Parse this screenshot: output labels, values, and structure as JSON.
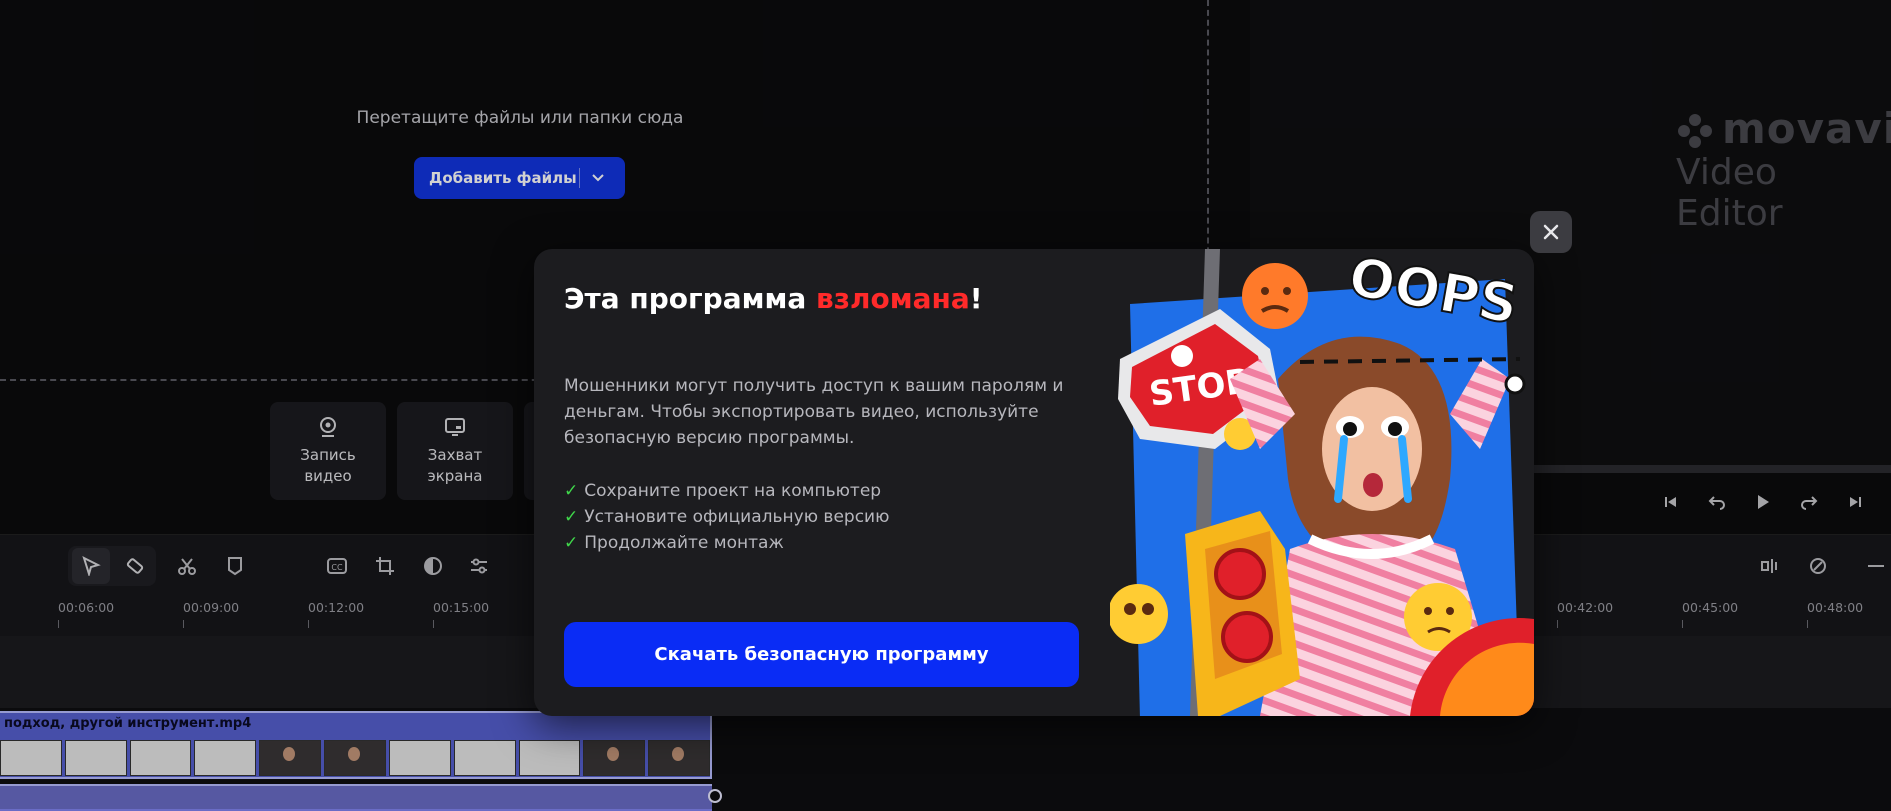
{
  "import": {
    "drop_text": "Перетащите файлы или папки сюда",
    "add_files_label": "Добавить файлы",
    "tiles": [
      {
        "line1": "Запись",
        "line2": "видео",
        "icon": "webcam-icon"
      },
      {
        "line1": "Захват",
        "line2": "экрана",
        "icon": "screen-capture-icon"
      }
    ]
  },
  "player": {
    "logo_text": "movavi",
    "logo_subtitle": "Video Editor"
  },
  "ruler": {
    "left_ticks": [
      "00:06:00",
      "00:09:00",
      "00:12:00",
      "00:15:00"
    ],
    "right_ticks": [
      "00:42:00",
      "00:45:00",
      "00:48:00"
    ]
  },
  "timeline": {
    "clip_name": "подход, другой инструмент.mp4"
  },
  "modal": {
    "title_prefix": "Эта программа ",
    "title_highlight": "взломана",
    "title_suffix": "!",
    "description": "Мошенники могут получить доступ к вашим паролям и деньгам. Чтобы экспортировать видео, используйте безопасную версию программы.",
    "checklist": [
      "Сохраните проект на компьютер",
      "Установите официальную версию",
      "Продолжайте монтаж"
    ],
    "cta_label": "Скачать безопасную программу",
    "art": {
      "oops_text": "OOPS",
      "stop_text": "STOP"
    }
  },
  "colors": {
    "accent_blue": "#0a2cf5",
    "highlight_red": "#ff2a2a",
    "check_green": "#3fd64a"
  }
}
